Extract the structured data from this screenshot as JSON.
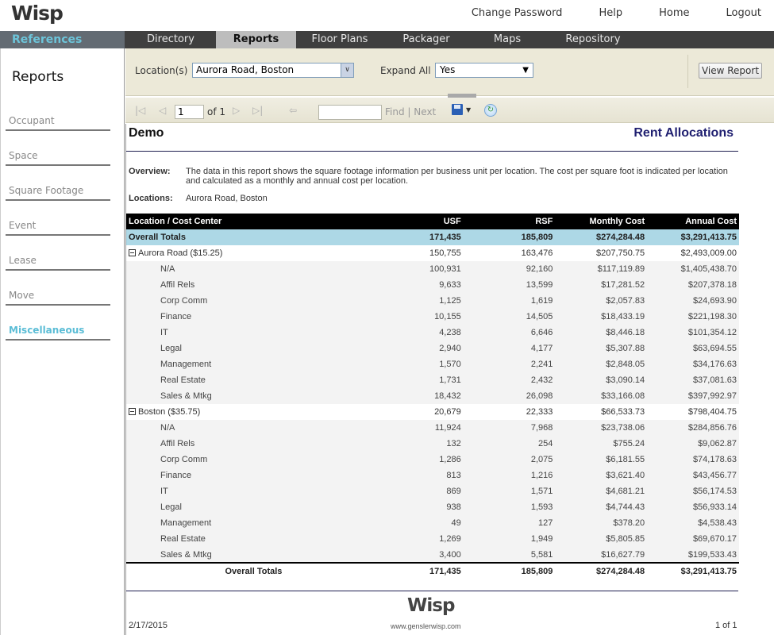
{
  "header": {
    "logo": "Wisp",
    "links": [
      "Change Password",
      "Help",
      "Home",
      "Logout"
    ]
  },
  "nav": {
    "section": "References",
    "tabs": [
      {
        "label": "Directory",
        "active": false
      },
      {
        "label": "Reports",
        "active": true
      },
      {
        "label": "Floor Plans",
        "active": false
      },
      {
        "label": "Packager",
        "active": false
      },
      {
        "label": "Maps",
        "active": false
      },
      {
        "label": "Repository",
        "active": false
      }
    ]
  },
  "sidebar": {
    "title": "Reports",
    "items": [
      {
        "label": "Occupant",
        "active": false
      },
      {
        "label": "Space",
        "active": false
      },
      {
        "label": "Square Footage",
        "active": false
      },
      {
        "label": "Event",
        "active": false
      },
      {
        "label": "Lease",
        "active": false
      },
      {
        "label": "Move",
        "active": false
      },
      {
        "label": "Miscellaneous",
        "active": true
      }
    ]
  },
  "params": {
    "location_label": "Location(s)",
    "location_value": "Aurora Road, Boston",
    "expand_label": "Expand All",
    "expand_value": "Yes",
    "view_report": "View Report"
  },
  "toolbar": {
    "page_value": "1",
    "of_pages": "of 1",
    "find_value": "",
    "find_label": "Find",
    "separator": "|",
    "next_label": "Next"
  },
  "report": {
    "company": "Demo",
    "title": "Rent Allocations",
    "overview_label": "Overview:",
    "overview_text": "The data in this report shows the square footage information per business unit per location.  The cost per square foot is indicated per location and calculated as a monthly and annual cost per location.",
    "locations_label": "Locations:",
    "locations_text": "Aurora Road, Boston",
    "columns": [
      "Location / Cost Center",
      "USF",
      "RSF",
      "Monthly Cost",
      "Annual Cost"
    ],
    "overall": {
      "label": "Overall Totals",
      "usf": "171,435",
      "rsf": "185,809",
      "monthly": "$274,284.48",
      "annual": "$3,291,413.75"
    },
    "locations": [
      {
        "label": "Aurora Road ($15.25)",
        "usf": "150,755",
        "rsf": "163,476",
        "monthly": "$207,750.75",
        "annual": "$2,493,009.00",
        "rows": [
          {
            "label": "N/A",
            "usf": "100,931",
            "rsf": "92,160",
            "monthly": "$117,119.89",
            "annual": "$1,405,438.70"
          },
          {
            "label": "Affil Rels",
            "usf": "9,633",
            "rsf": "13,599",
            "monthly": "$17,281.52",
            "annual": "$207,378.18"
          },
          {
            "label": "Corp Comm",
            "usf": "1,125",
            "rsf": "1,619",
            "monthly": "$2,057.83",
            "annual": "$24,693.90"
          },
          {
            "label": "Finance",
            "usf": "10,155",
            "rsf": "14,505",
            "monthly": "$18,433.19",
            "annual": "$221,198.30"
          },
          {
            "label": "IT",
            "usf": "4,238",
            "rsf": "6,646",
            "monthly": "$8,446.18",
            "annual": "$101,354.12"
          },
          {
            "label": "Legal",
            "usf": "2,940",
            "rsf": "4,177",
            "monthly": "$5,307.88",
            "annual": "$63,694.55"
          },
          {
            "label": "Management",
            "usf": "1,570",
            "rsf": "2,241",
            "monthly": "$2,848.05",
            "annual": "$34,176.63"
          },
          {
            "label": "Real Estate",
            "usf": "1,731",
            "rsf": "2,432",
            "monthly": "$3,090.14",
            "annual": "$37,081.63"
          },
          {
            "label": "Sales & Mtkg",
            "usf": "18,432",
            "rsf": "26,098",
            "monthly": "$33,166.08",
            "annual": "$397,992.97"
          }
        ]
      },
      {
        "label": "Boston ($35.75)",
        "usf": "20,679",
        "rsf": "22,333",
        "monthly": "$66,533.73",
        "annual": "$798,404.75",
        "rows": [
          {
            "label": "N/A",
            "usf": "11,924",
            "rsf": "7,968",
            "monthly": "$23,738.06",
            "annual": "$284,856.76"
          },
          {
            "label": "Affil Rels",
            "usf": "132",
            "rsf": "254",
            "monthly": "$755.24",
            "annual": "$9,062.87"
          },
          {
            "label": "Corp Comm",
            "usf": "1,286",
            "rsf": "2,075",
            "monthly": "$6,181.55",
            "annual": "$74,178.63"
          },
          {
            "label": "Finance",
            "usf": "813",
            "rsf": "1,216",
            "monthly": "$3,621.40",
            "annual": "$43,456.77"
          },
          {
            "label": "IT",
            "usf": "869",
            "rsf": "1,571",
            "monthly": "$4,681.21",
            "annual": "$56,174.53"
          },
          {
            "label": "Legal",
            "usf": "938",
            "rsf": "1,593",
            "monthly": "$4,744.43",
            "annual": "$56,933.14"
          },
          {
            "label": "Management",
            "usf": "49",
            "rsf": "127",
            "monthly": "$378.20",
            "annual": "$4,538.43"
          },
          {
            "label": "Real Estate",
            "usf": "1,269",
            "rsf": "1,949",
            "monthly": "$5,805.85",
            "annual": "$69,670.17"
          },
          {
            "label": "Sales & Mtkg",
            "usf": "3,400",
            "rsf": "5,581",
            "monthly": "$16,627.79",
            "annual": "$199,533.43"
          }
        ]
      }
    ],
    "footer_totals": {
      "label": "Overall Totals",
      "usf": "171,435",
      "rsf": "185,809",
      "monthly": "$274,284.48",
      "annual": "$3,291,413.75"
    },
    "footer": {
      "logo": "Wisp",
      "date": "2/17/2015",
      "url": "www.genslerwisp.com",
      "page": "1 of 1"
    }
  },
  "colors": {
    "accent": "#5bbdd6",
    "nav_bg": "#3f3f3f",
    "overall_row": "#add8e6",
    "report_title": "#1f1f70"
  }
}
